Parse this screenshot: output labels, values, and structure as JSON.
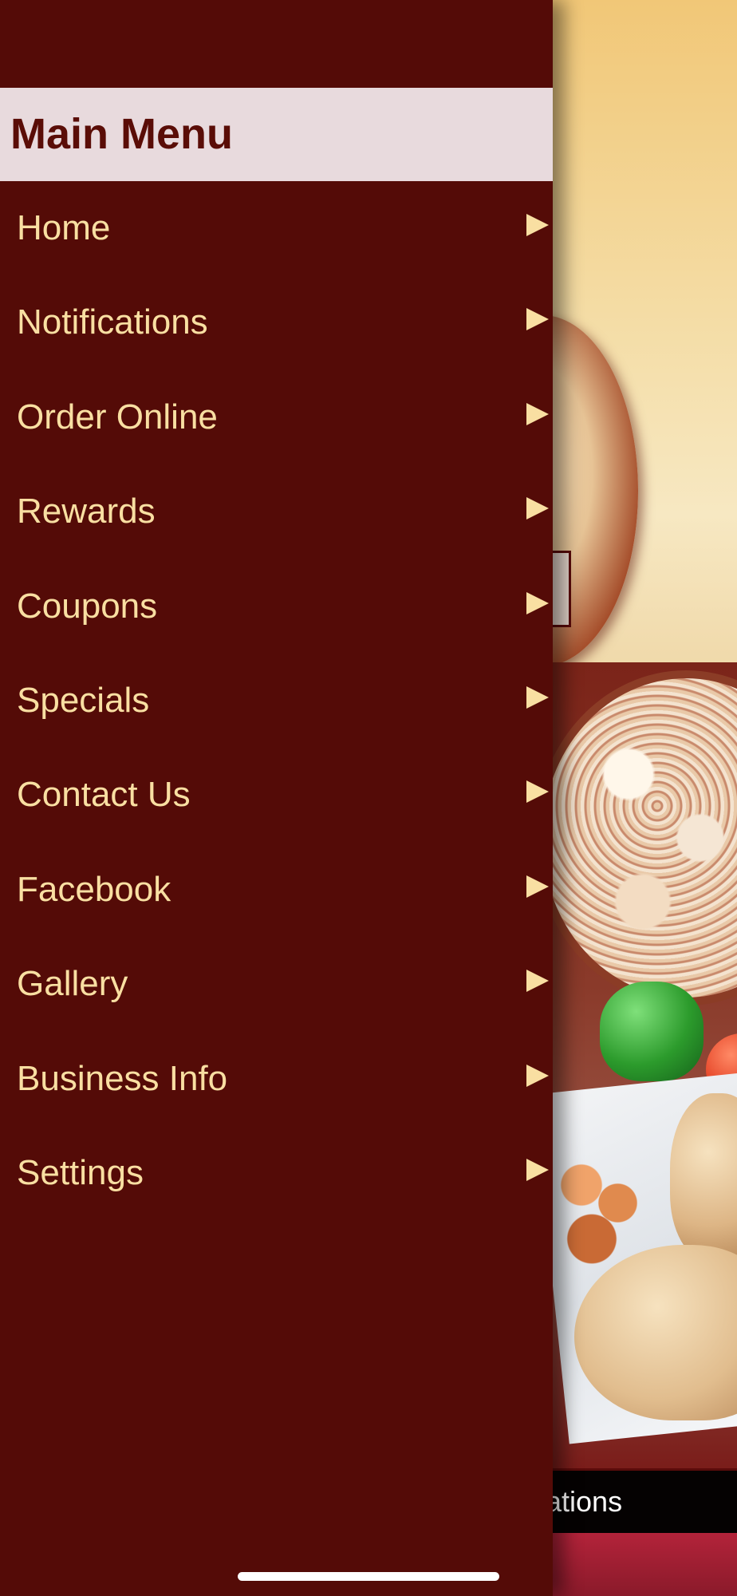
{
  "drawer": {
    "title": "Main Menu",
    "items": [
      {
        "label": "Home"
      },
      {
        "label": "Notifications"
      },
      {
        "label": "Order Online"
      },
      {
        "label": "Rewards"
      },
      {
        "label": "Coupons"
      },
      {
        "label": "Specials"
      },
      {
        "label": "Contact Us"
      },
      {
        "label": "Facebook"
      },
      {
        "label": "Gallery"
      },
      {
        "label": "Business Info"
      },
      {
        "label": "Settings"
      }
    ],
    "arrow_icon": "triangle-right-icon"
  },
  "background": {
    "tab_bar_text": "ifications"
  },
  "colors": {
    "drawer_bg": "#540b07",
    "header_bg": "#e8dadd",
    "title_text": "#5a0d07",
    "item_text": "#f9dfa2"
  }
}
